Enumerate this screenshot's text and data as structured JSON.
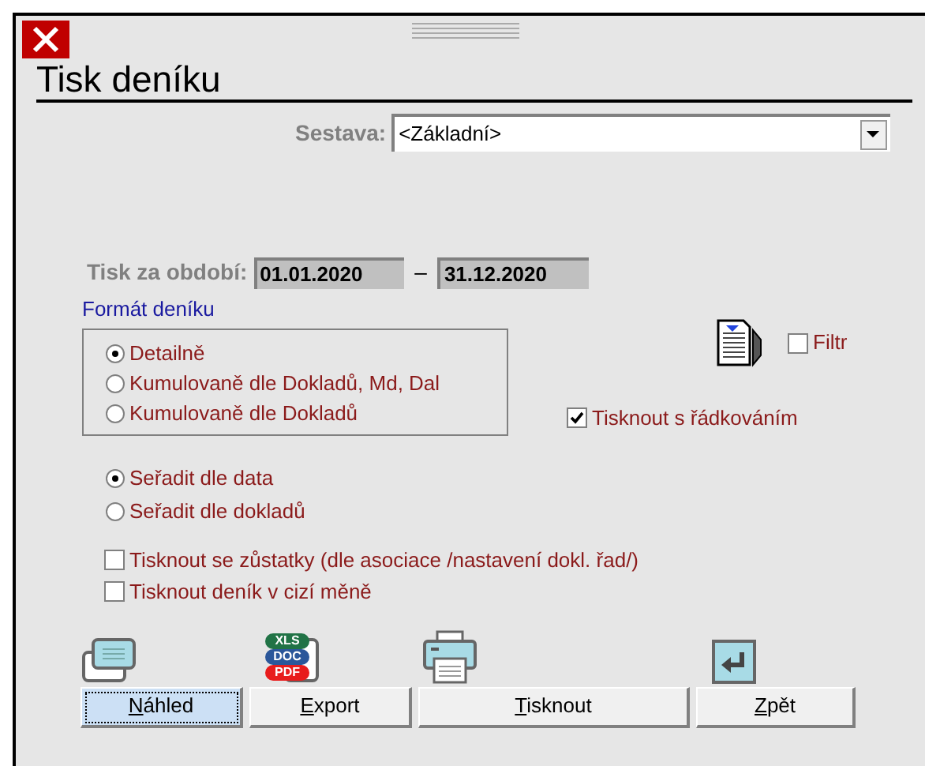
{
  "window": {
    "title": "Tisk deníku"
  },
  "sestava": {
    "label": "Sestava:",
    "value": "<Základní>"
  },
  "period": {
    "label": "Tisk za období:",
    "from": "01.01.2020",
    "dash": "–",
    "to": "31.12.2020"
  },
  "format": {
    "label": "Formát deníku",
    "options": [
      {
        "label": "Detailně",
        "selected": true
      },
      {
        "label": "Kumulovaně dle Dokladů, Md, Dal",
        "selected": false
      },
      {
        "label": "Kumulovaně dle Dokladů",
        "selected": false
      }
    ]
  },
  "filter": {
    "label": "Filtr",
    "checked": false
  },
  "line_spacing": {
    "label": "Tisknout s řádkováním",
    "checked": true
  },
  "sort": [
    {
      "label": "Seřadit dle data",
      "selected": true
    },
    {
      "label": "Seřadit dle dokladů",
      "selected": false
    }
  ],
  "options": [
    {
      "label": "Tisknout se zůstatky (dle asociace /nastavení dokl. řad/)",
      "checked": false
    },
    {
      "label": "Tisknout deník v cizí měně",
      "checked": false
    }
  ],
  "export_badges": [
    "XLS",
    "DOC",
    "PDF"
  ],
  "buttons": [
    {
      "kind": "preview",
      "accel": "N",
      "rest": "áhled",
      "focused": true
    },
    {
      "kind": "export",
      "accel": "E",
      "rest": "xport",
      "focused": false
    },
    {
      "kind": "print",
      "accel": "T",
      "rest": "isknout",
      "focused": false
    },
    {
      "kind": "back",
      "accel": "Z",
      "rest": "pět",
      "focused": false
    }
  ]
}
